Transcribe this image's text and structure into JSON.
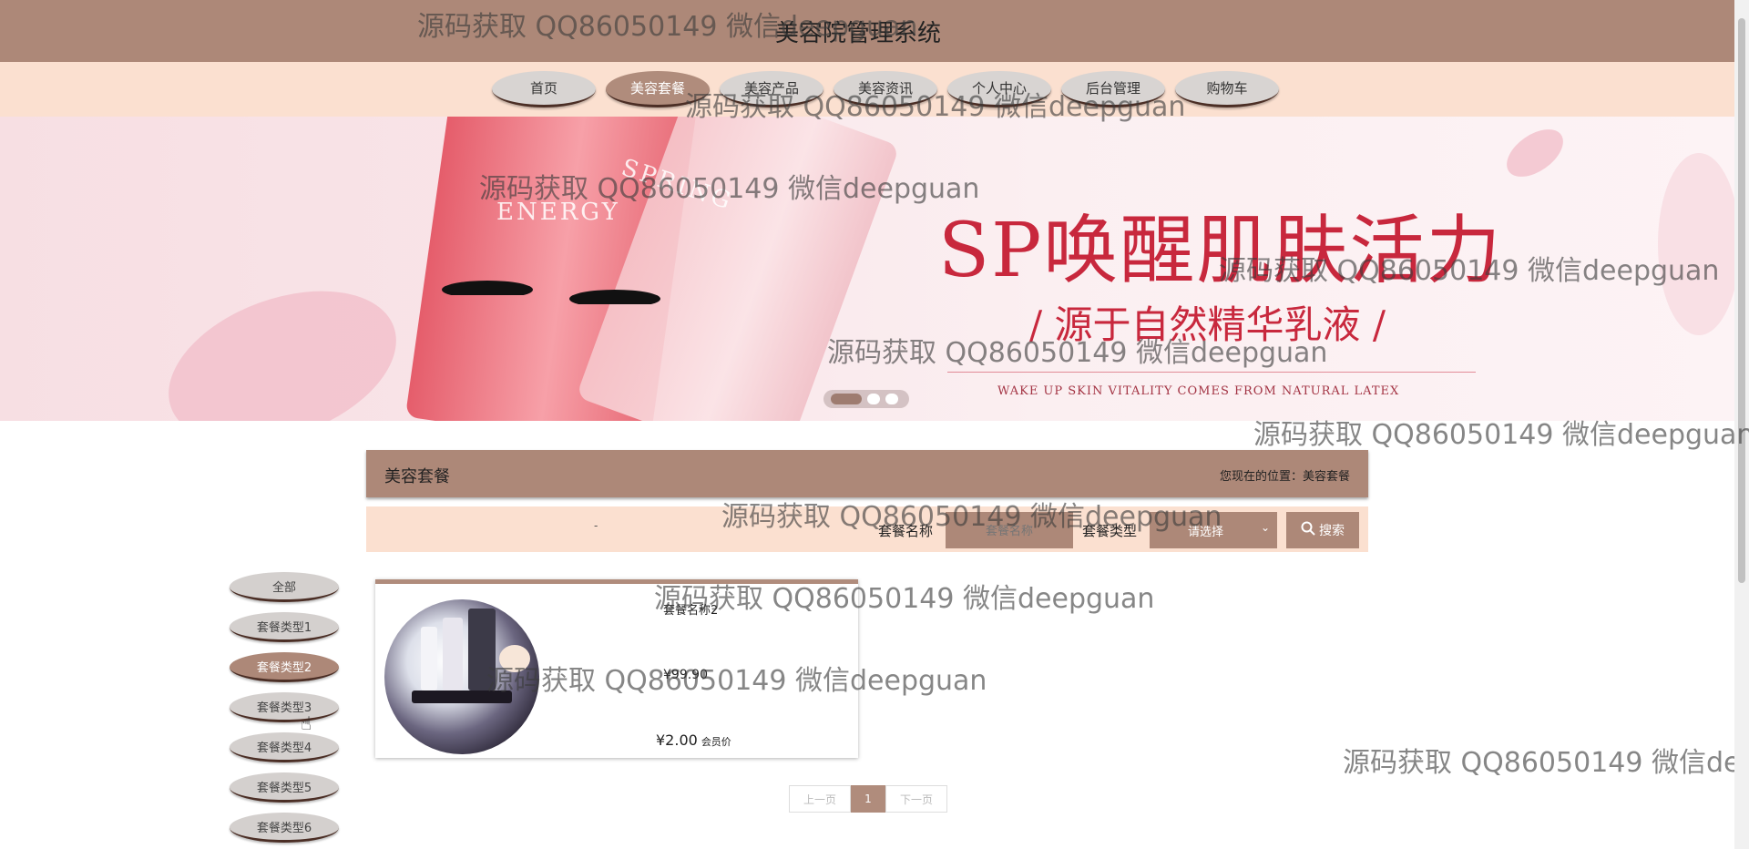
{
  "header": {
    "title": "美容院管理系统"
  },
  "nav": {
    "items": [
      {
        "label": "首页",
        "active": false
      },
      {
        "label": "美容套餐",
        "active": true
      },
      {
        "label": "美容产品",
        "active": false
      },
      {
        "label": "美容资讯",
        "active": false
      },
      {
        "label": "个人中心",
        "active": false
      },
      {
        "label": "后台管理",
        "active": false
      },
      {
        "label": "购物车",
        "active": false
      }
    ]
  },
  "banner": {
    "headline": "SP唤醒肌肤活力",
    "subline": "/ 源于自然精华乳液 /",
    "english": "WAKE UP SKIN VITALITY COMES FROM NATURAL LATEX",
    "tube_text_1": "ENERGY",
    "tube_text_2": "SPRING",
    "slides": 3,
    "active_slide": 1
  },
  "section": {
    "title": "美容套餐",
    "location": "您现在的位置：美容套餐"
  },
  "search": {
    "dash": "-",
    "name_label": "套餐名称",
    "name_placeholder": "套餐名称",
    "type_label": "套餐类型",
    "type_selected": "请选择",
    "button_label": "搜索"
  },
  "categories": [
    {
      "label": "全部",
      "active": false
    },
    {
      "label": "套餐类型1",
      "active": false
    },
    {
      "label": "套餐类型2",
      "active": true
    },
    {
      "label": "套餐类型3",
      "active": false
    },
    {
      "label": "套餐类型4",
      "active": false
    },
    {
      "label": "套餐类型5",
      "active": false
    },
    {
      "label": "套餐类型6",
      "active": false
    }
  ],
  "product": {
    "name": "套餐名称2",
    "price": "¥99.90",
    "member_price": "¥2.00",
    "member_label": "会员价"
  },
  "pagination": {
    "prev": "上一页",
    "current": "1",
    "next": "下一页"
  },
  "watermark": "源码获取 QQ86050149 微信deepguan",
  "colors": {
    "brand": "#ad8878",
    "nav_bg": "#fbe0d0",
    "active_pill": "#b08c7c",
    "banner_text": "#c8283d"
  }
}
